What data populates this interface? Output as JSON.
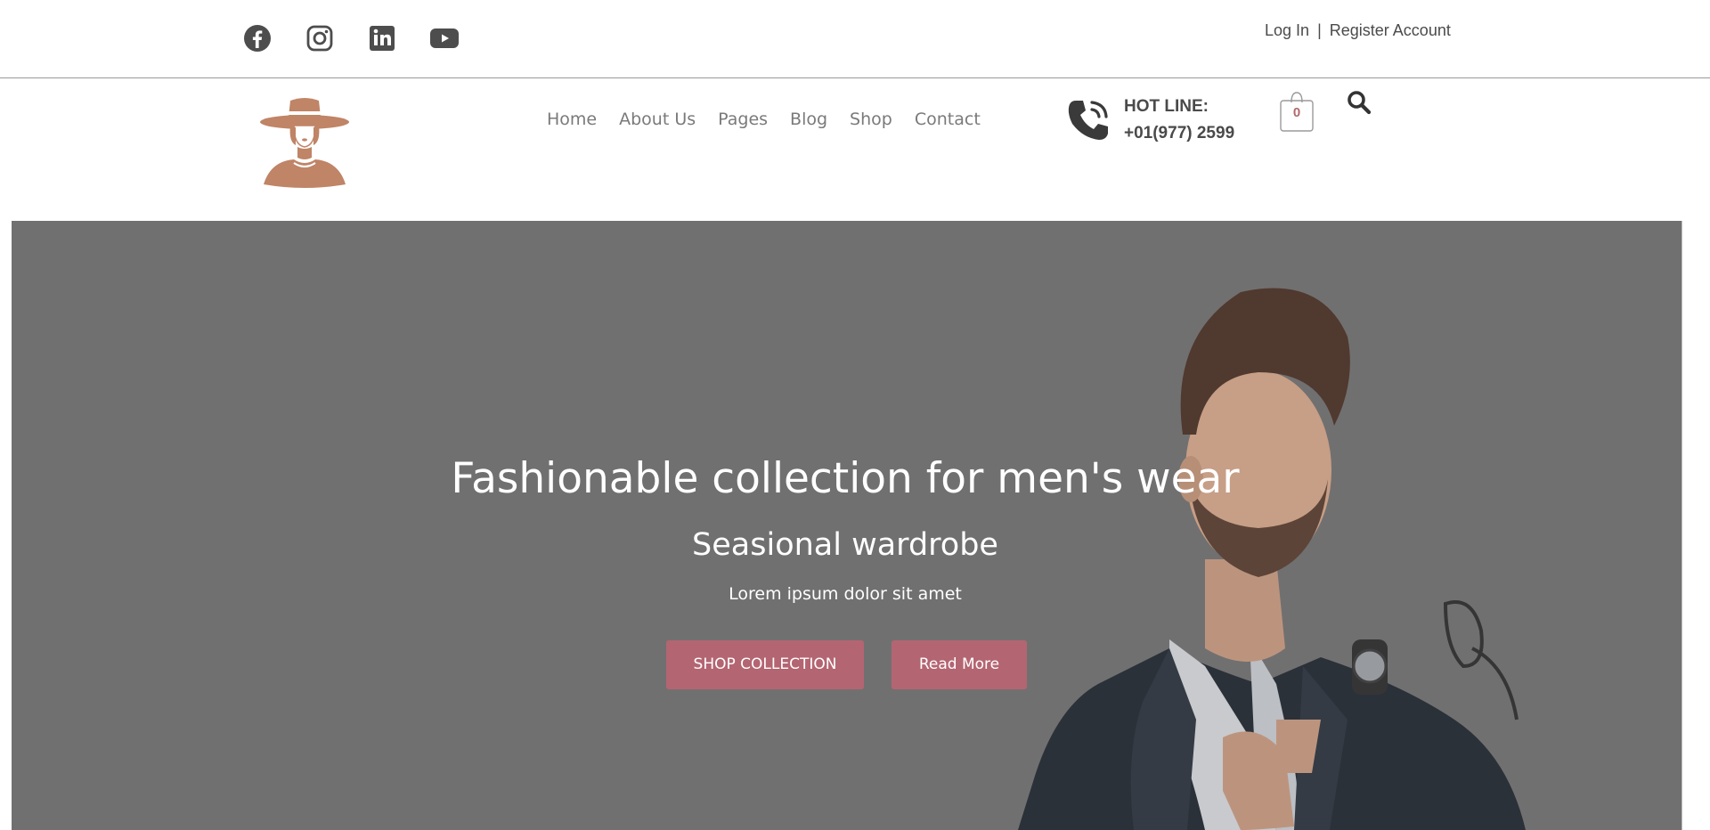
{
  "topbar": {
    "social": [
      {
        "icon": "facebook-icon"
      },
      {
        "icon": "instagram-icon"
      },
      {
        "icon": "linkedin-icon"
      },
      {
        "icon": "youtube-icon"
      }
    ],
    "login_label": "Log In",
    "separator": "|",
    "register_label": "Register Account"
  },
  "header": {
    "logo_icon": "woman-with-hat-logo",
    "nav": {
      "home": "Home",
      "about": "About Us",
      "pages": "Pages",
      "blog": "Blog",
      "shop": "Shop",
      "contact": "Contact"
    },
    "hotline": {
      "icon": "phone-icon",
      "label": "HOT LINE:",
      "number": "+01(977) 2599"
    },
    "cart": {
      "icon": "shopping-bag-icon",
      "count": "0"
    },
    "search_icon": "search-icon"
  },
  "hero": {
    "title": "Fashionable collection for men's wear",
    "subtitle": "Seasional wardrobe",
    "description": "Lorem ipsum dolor sit amet",
    "primary_button": "SHOP COLLECTION",
    "secondary_button": "Read More"
  },
  "colors": {
    "brand_logo": "#c08466",
    "button": "#b46572",
    "hero_overlay": "#717070",
    "cart_count": "#b06a6a"
  }
}
